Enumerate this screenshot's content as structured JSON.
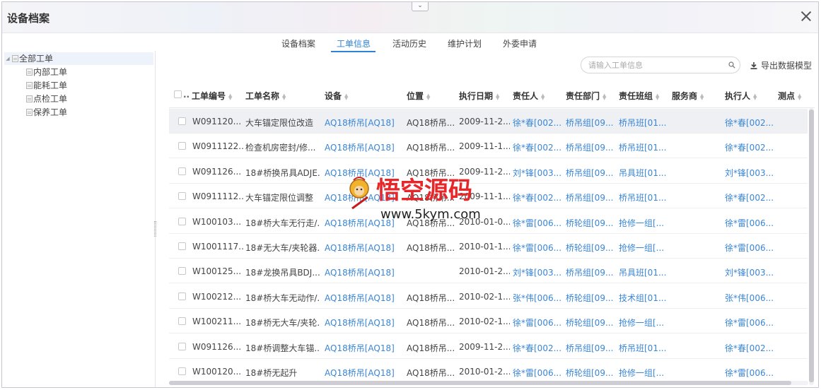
{
  "window": {
    "title": "设备档案"
  },
  "tabs": [
    {
      "label": "设备档案",
      "active": false
    },
    {
      "label": "工单信息",
      "active": true
    },
    {
      "label": "活动历史",
      "active": false
    },
    {
      "label": "维护计划",
      "active": false
    },
    {
      "label": "外委申请",
      "active": false
    }
  ],
  "tree": {
    "root": "全部工单",
    "children": [
      "内部工单",
      "能耗工单",
      "点检工单",
      "保养工单"
    ]
  },
  "toolbar": {
    "search_placeholder": "请输入工单信息",
    "export_label": "导出数据模型"
  },
  "table": {
    "columns": [
      "工单编号",
      "工单名称",
      "设备",
      "位置",
      "执行日期",
      "责任人",
      "责任部门",
      "责任班组",
      "服务商",
      "执行人",
      "测点"
    ],
    "rows": [
      [
        "W091120...",
        "大车锚定限位改造",
        "AQ18桥吊[AQ18]",
        "AQ18桥吊...",
        "2009-11-2...",
        "徐*春[002...",
        "桥吊组[09...",
        "桥吊班[01...",
        "",
        "徐*春[002...",
        ""
      ],
      [
        "W0911122...",
        "检查机房密封/修...",
        "AQ18桥吊[AQ18]",
        "AQ18桥吊...",
        "2009-11-1...",
        "徐*春[002...",
        "桥吊组[09...",
        "桥吊班[01...",
        "",
        "徐*春[002...",
        ""
      ],
      [
        "W091126...",
        "18#桥换吊具ADJE...",
        "AQ18桥吊[AQ18]",
        "AQ18桥吊...",
        "2009-11-2...",
        "刘*锋[003...",
        "桥吊组[09...",
        "吊具班[01...",
        "",
        "刘*锋[003...",
        ""
      ],
      [
        "W0911112...",
        "大车锚定限位调整",
        "AQ18桥吊[AQ18]",
        "AQ18桥吊...",
        "2009-11-1...",
        "徐*春[002...",
        "桥吊组[09...",
        "桥吊班[01...",
        "",
        "徐*春[002...",
        ""
      ],
      [
        "W100103...",
        "18#桥大车无行走/...",
        "AQ18桥吊[AQ18]",
        "AQ18桥吊...",
        "2010-01-0...",
        "徐*雷[006...",
        "桥轮组[09...",
        "抢修一组[...",
        "",
        "徐*雷[006...",
        ""
      ],
      [
        "W1001117...",
        "18#无大车/夹轮器...",
        "AQ18桥吊[AQ18]",
        "AQ18桥吊...",
        "2010-01-1...",
        "徐*雷[006...",
        "桥轮组[09...",
        "抢修一组[...",
        "",
        "徐*雷[006...",
        ""
      ],
      [
        "W100125...",
        "18#龙换吊具BDJ...",
        "AQ18桥吊[AQ18]",
        "",
        "2010-01-2...",
        "刘*锋[003...",
        "桥吊组[09...",
        "吊具班[01...",
        "",
        "刘*锋[003...",
        ""
      ],
      [
        "W100212...",
        "18#桥大车无动作/...",
        "AQ18桥吊[AQ18]",
        "AQ18桥吊...",
        "2010-02-1...",
        "张*伟[006...",
        "桥轮组[09...",
        "技术组[01...",
        "",
        "张*伟[006...",
        ""
      ],
      [
        "W100211...",
        "18#桥无大车/夹轮...",
        "AQ18桥吊[AQ18]",
        "AQ18桥吊...",
        "2010-02-1...",
        "徐*雷[006...",
        "桥轮组[09...",
        "抢修一组[...",
        "",
        "徐*雷[006...",
        ""
      ],
      [
        "W091126...",
        "18#桥调整大车锚...",
        "AQ18桥吊[AQ18]",
        "AQ18桥吊...",
        "2009-11-2...",
        "徐*春[002...",
        "桥吊组[09...",
        "桥吊班[01...",
        "",
        "徐*春[002...",
        ""
      ],
      [
        "W100120...",
        "18#桥无起升",
        "AQ18桥吊[AQ18]",
        "AQ18桥吊...",
        "2010-01-2...",
        "徐*雷[006...",
        "桥轮组[09...",
        "抢修一组[...",
        "",
        "徐*雷[006...",
        ""
      ]
    ]
  },
  "watermark": {
    "title": "悟空源码",
    "url": "www.5kym.com"
  },
  "colors": {
    "accent": "#2f82d8",
    "link": "#3a86d6",
    "selected_row": "#eef0f4",
    "watermark_red": "#e8262a"
  }
}
